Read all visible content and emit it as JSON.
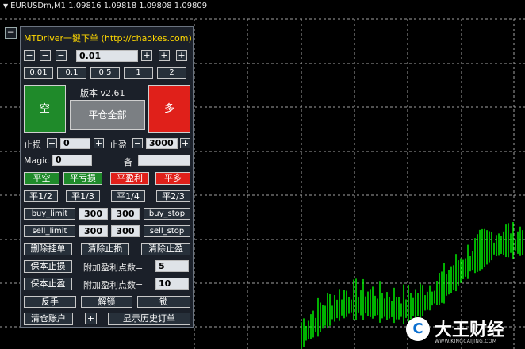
{
  "chart": {
    "header": "EURUSDm,M1  1.09816 1.09818 1.09808 1.09809",
    "collapse_label": "−"
  },
  "panel": {
    "title": "MTDriver一键下单 (http://chaokes.com)",
    "lot": {
      "minus": "−",
      "plus": "+",
      "value": "0.01",
      "presets": [
        "0.01",
        "0.1",
        "0.5",
        "1",
        "2"
      ]
    },
    "version": "版本 v2.61",
    "sell_label": "空",
    "close_all_label": "平仓全部",
    "buy_label": "多",
    "stoploss_label": "止损",
    "stoploss_value": "0",
    "takeprofit_label": "止盈",
    "takeprofit_value": "3000",
    "step_minus": "−",
    "step_plus": "+",
    "magic_label": "Magic",
    "magic_value": "0",
    "note_label": "备",
    "note_value": "",
    "close_row": [
      "平空",
      "平亏损",
      "平盈利",
      "平多"
    ],
    "partial_row": [
      "平1/2",
      "平1/3",
      "平1/4",
      "平2/3"
    ],
    "buy_limit_label": "buy_limit",
    "buy_limit_a": "300",
    "buy_limit_b": "300",
    "buy_stop_label": "buy_stop",
    "sell_limit_label": "sell_limit",
    "sell_limit_a": "300",
    "sell_limit_b": "300",
    "sell_stop_label": "sell_stop",
    "delete_pending": "删除挂单",
    "clear_sl": "清除止损",
    "clear_tp": "清除止盈",
    "breakeven_sl": "保本止损",
    "extra_tp_label": "附加盈利点数=",
    "extra_tp_value": "5",
    "breakeven_tp": "保本止盈",
    "extra_tp_label2": "附加盈利点数=",
    "extra_tp_value2": "10",
    "reverse": "反手",
    "unlock": "解锁",
    "lock": "锁",
    "clear_account": "清仓账户",
    "clear_account_plus": "+",
    "show_history": "显示历史订单"
  },
  "watermark": {
    "name": "大王财经",
    "url": "WWW.KINGCAIJING.COM"
  },
  "colors": {
    "panel_bg": "#1b2029",
    "title": "#ffd800",
    "green": "#1f8a2a",
    "red": "#e0201a",
    "candle": "#00ff00",
    "grid": "#c8c8c8"
  }
}
